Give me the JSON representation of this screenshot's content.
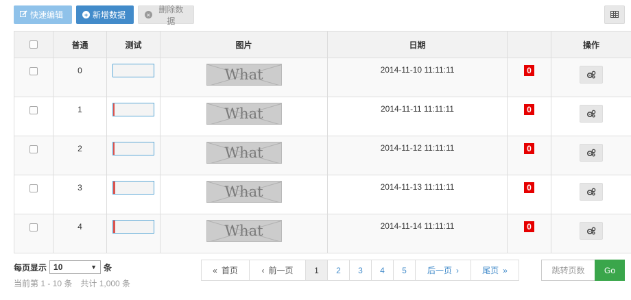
{
  "toolbar": {
    "quick_edit_label": "快速编辑",
    "add_label": "新增数据",
    "delete_label": "删除数据"
  },
  "table": {
    "headers": [
      "普通",
      "测试",
      "图片",
      "日期",
      "",
      "操作"
    ],
    "image_placeholder_text": "What",
    "rows": [
      {
        "id": "0",
        "date": "2014-11-10 11:11:11",
        "badge": "0",
        "progress": 0
      },
      {
        "id": "1",
        "date": "2014-11-11 11:11:11",
        "badge": "0",
        "progress": 0.04
      },
      {
        "id": "2",
        "date": "2014-11-12 11:11:11",
        "badge": "0",
        "progress": 0.04
      },
      {
        "id": "3",
        "date": "2014-11-13 11:11:11",
        "badge": "0",
        "progress": 0.05
      },
      {
        "id": "4",
        "date": "2014-11-14 11:11:11",
        "badge": "0",
        "progress": 0.05
      }
    ]
  },
  "footer": {
    "per_page_label": "每页显示",
    "per_page_value": "10",
    "per_page_unit": "条",
    "summary": "当前第 1 - 10 条　共计 1,000 条"
  },
  "pagination": {
    "first": "首页",
    "prev": "前一页",
    "pages": [
      "1",
      "2",
      "3",
      "4",
      "5"
    ],
    "active_page": "1",
    "next": "后一页",
    "last": "尾页",
    "jump_placeholder": "跳转页数",
    "go": "Go"
  },
  "colors": {
    "primary": "#428bca",
    "primary_light": "#8fc2ea",
    "badge_red": "#e60000",
    "go_green": "#3aa64b"
  }
}
